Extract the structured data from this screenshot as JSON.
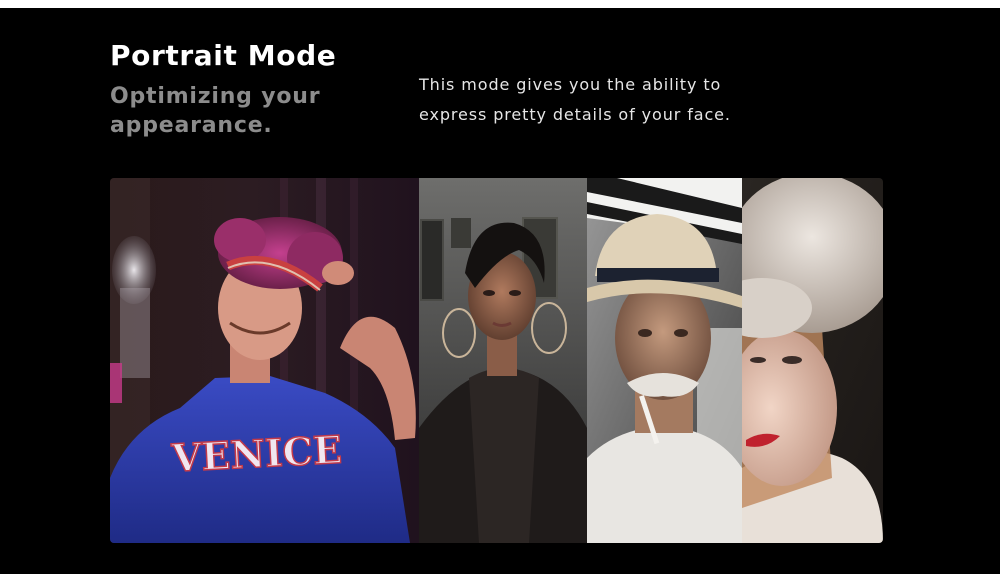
{
  "header": {
    "title": "Portrait Mode",
    "subtitle": "Optimizing your appearance.",
    "description": "This mode gives you the ability to\nexpress  pretty details of your face."
  },
  "gallery": {
    "photos": [
      {
        "subject": "Young man with curly hair and headband wearing blue VENICE t-shirt",
        "shirt_text": "VENICE"
      },
      {
        "subject": "Woman with short dark hair and hoop earrings"
      },
      {
        "subject": "Older man in straw hat with cigarette"
      },
      {
        "subject": "Woman in white fur hat with red lips"
      }
    ]
  },
  "colors": {
    "background": "#000000",
    "title": "#ffffff",
    "subtitle": "#8c8c8c",
    "description": "#e6e6e6",
    "shirt_blue": "#2f3fa8",
    "magenta_light": "#d63ca0"
  }
}
